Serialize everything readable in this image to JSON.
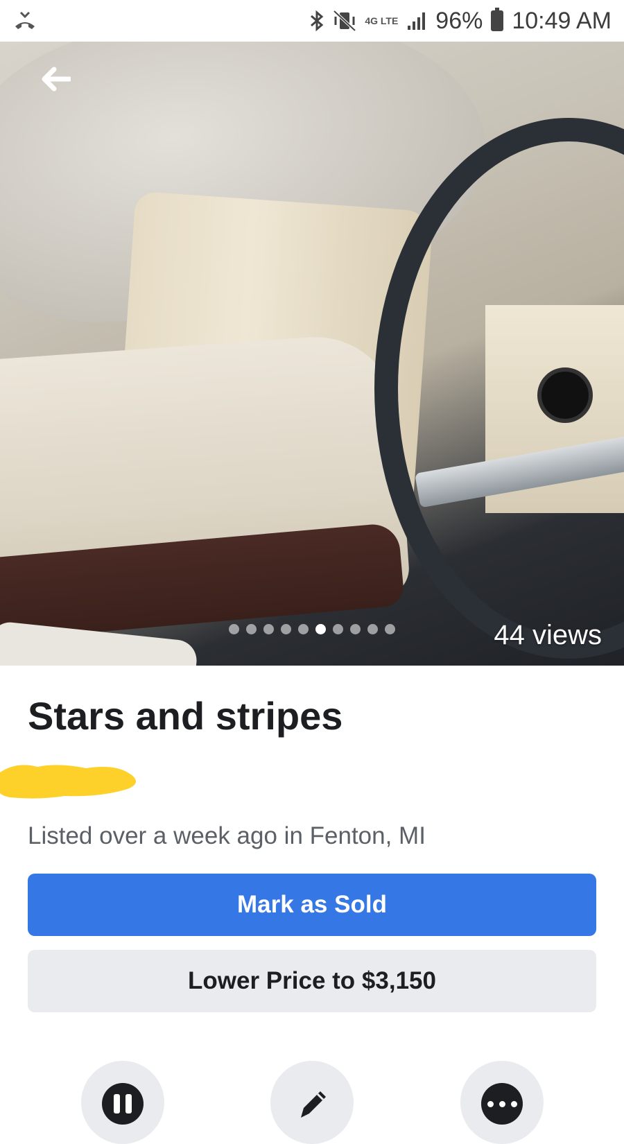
{
  "status_bar": {
    "left_icon": "missed-call-icon",
    "icons": [
      "bluetooth-icon",
      "vibrate-mute-icon",
      "4g-lte-icon",
      "signal-icon",
      "battery-icon"
    ],
    "network": "4G LTE",
    "battery": "96%",
    "time": "10:49 AM"
  },
  "photo": {
    "back_icon": "back-arrow-icon",
    "carousel_count": 10,
    "carousel_active_index": 5,
    "views": "44 views"
  },
  "listing": {
    "title": "Stars and stripes",
    "price_redaction_color": "#fdd02a",
    "listed_text": "Listed over a week ago in Fenton, MI"
  },
  "buttons": {
    "mark_sold": "Mark as Sold",
    "lower_price": "Lower Price to $3,150"
  },
  "actions": [
    {
      "icon": "pause-icon"
    },
    {
      "icon": "edit-pencil-icon"
    },
    {
      "icon": "more-icon"
    }
  ],
  "colors": {
    "accent": "#3578e5",
    "secondary_button": "#e9ebee",
    "text_primary": "#1c1e21",
    "text_secondary": "#5b5f66"
  }
}
